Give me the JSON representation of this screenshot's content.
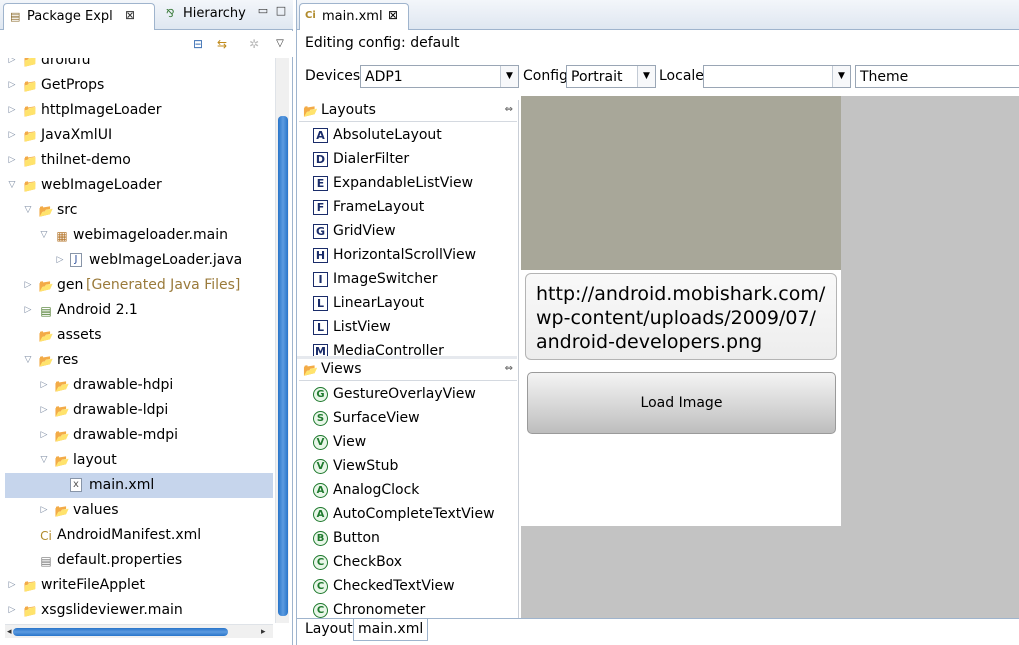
{
  "explorer": {
    "tabs": [
      {
        "label": "Package Expl",
        "icon": "package-explorer-icon"
      },
      {
        "label": "Hierarchy",
        "icon": "hierarchy-icon"
      }
    ],
    "close_glyph": "⊠",
    "tree": [
      {
        "label": "droidfu",
        "level": 1,
        "expanded": false,
        "icon": "project-icon"
      },
      {
        "label": "GetProps",
        "level": 1,
        "expanded": false,
        "icon": "project-icon"
      },
      {
        "label": "httpImageLoader",
        "level": 1,
        "expanded": false,
        "icon": "project-icon"
      },
      {
        "label": "JavaXmlUI",
        "level": 1,
        "expanded": false,
        "icon": "project-icon"
      },
      {
        "label": "thilnet-demo",
        "level": 1,
        "expanded": false,
        "icon": "project-icon"
      },
      {
        "label": "webImageLoader",
        "level": 1,
        "expanded": true,
        "icon": "project-icon"
      },
      {
        "label": "src",
        "level": 2,
        "expanded": true,
        "icon": "source-folder-icon"
      },
      {
        "label": "webimageloader.main",
        "level": 3,
        "expanded": true,
        "icon": "package-icon"
      },
      {
        "label": "webImageLoader.java",
        "level": 4,
        "expanded": false,
        "icon": "java-file-icon"
      },
      {
        "label": "gen",
        "suffix": "[Generated Java Files]",
        "level": 2,
        "expanded": false,
        "icon": "source-folder-icon"
      },
      {
        "label": "Android 2.1",
        "level": 2,
        "expanded": false,
        "icon": "library-icon"
      },
      {
        "label": "assets",
        "level": 2,
        "expanded": null,
        "icon": "folder-icon"
      },
      {
        "label": "res",
        "level": 2,
        "expanded": true,
        "icon": "folder-icon"
      },
      {
        "label": "drawable-hdpi",
        "level": 3,
        "expanded": false,
        "icon": "folder-icon"
      },
      {
        "label": "drawable-ldpi",
        "level": 3,
        "expanded": false,
        "icon": "folder-icon"
      },
      {
        "label": "drawable-mdpi",
        "level": 3,
        "expanded": false,
        "icon": "folder-icon"
      },
      {
        "label": "layout",
        "level": 3,
        "expanded": true,
        "icon": "folder-icon"
      },
      {
        "label": "main.xml",
        "level": 4,
        "expanded": null,
        "icon": "xml-file-icon",
        "selected": true
      },
      {
        "label": "values",
        "level": 3,
        "expanded": false,
        "icon": "folder-icon"
      },
      {
        "label": "AndroidManifest.xml",
        "level": 2,
        "expanded": null,
        "icon": "manifest-icon"
      },
      {
        "label": "default.properties",
        "level": 2,
        "expanded": null,
        "icon": "properties-file-icon"
      },
      {
        "label": "writeFileApplet",
        "level": 1,
        "expanded": false,
        "icon": "project-icon"
      },
      {
        "label": "xsgslideviewer.main",
        "level": 1,
        "expanded": false,
        "icon": "project-icon"
      }
    ]
  },
  "editor": {
    "tab_label": "main.xml",
    "editing_config": "Editing config: default",
    "config": {
      "devices_label": "Devices",
      "devices_value": "ADP1",
      "config_label": "Config",
      "config_value": "Portrait",
      "locale_label": "Locale",
      "locale_value": "",
      "theme_value": "Theme"
    },
    "palette": {
      "groups": [
        {
          "label": "Layouts",
          "items": [
            {
              "letter": "A",
              "label": "AbsoluteLayout"
            },
            {
              "letter": "D",
              "label": "DialerFilter"
            },
            {
              "letter": "E",
              "label": "ExpandableListView"
            },
            {
              "letter": "F",
              "label": "FrameLayout"
            },
            {
              "letter": "G",
              "label": "GridView"
            },
            {
              "letter": "H",
              "label": "HorizontalScrollView"
            },
            {
              "letter": "I",
              "label": "ImageSwitcher"
            },
            {
              "letter": "L",
              "label": "LinearLayout"
            },
            {
              "letter": "L",
              "label": "ListView"
            },
            {
              "letter": "M",
              "label": "MediaController"
            }
          ]
        },
        {
          "label": "Views",
          "items": [
            {
              "letter": "G",
              "label": "GestureOverlayView"
            },
            {
              "letter": "S",
              "label": "SurfaceView"
            },
            {
              "letter": "V",
              "label": "View"
            },
            {
              "letter": "V",
              "label": "ViewStub"
            },
            {
              "letter": "A",
              "label": "AnalogClock"
            },
            {
              "letter": "A",
              "label": "AutoCompleteTextView"
            },
            {
              "letter": "B",
              "label": "Button"
            },
            {
              "letter": "C",
              "label": "CheckBox"
            },
            {
              "letter": "C",
              "label": "CheckedTextView"
            },
            {
              "letter": "C",
              "label": "Chronometer"
            }
          ]
        }
      ]
    },
    "preview": {
      "url_text": "http://android.mobishark.com/ wp-content/uploads/2009/07/ android-developers.png",
      "url_lines": [
        "http://android.mobishark.com/",
        "wp-content/uploads/2009/07/",
        "android-developers.png"
      ],
      "button_label": "Load Image"
    },
    "bottom_tabs": [
      "Layout",
      "main.xml"
    ]
  },
  "colors": {
    "selection": "#c6d5ec",
    "image_placeholder": "#a8a799",
    "canvas_background": "#c3c3c3",
    "scroll_thumb": "#2874c9"
  }
}
